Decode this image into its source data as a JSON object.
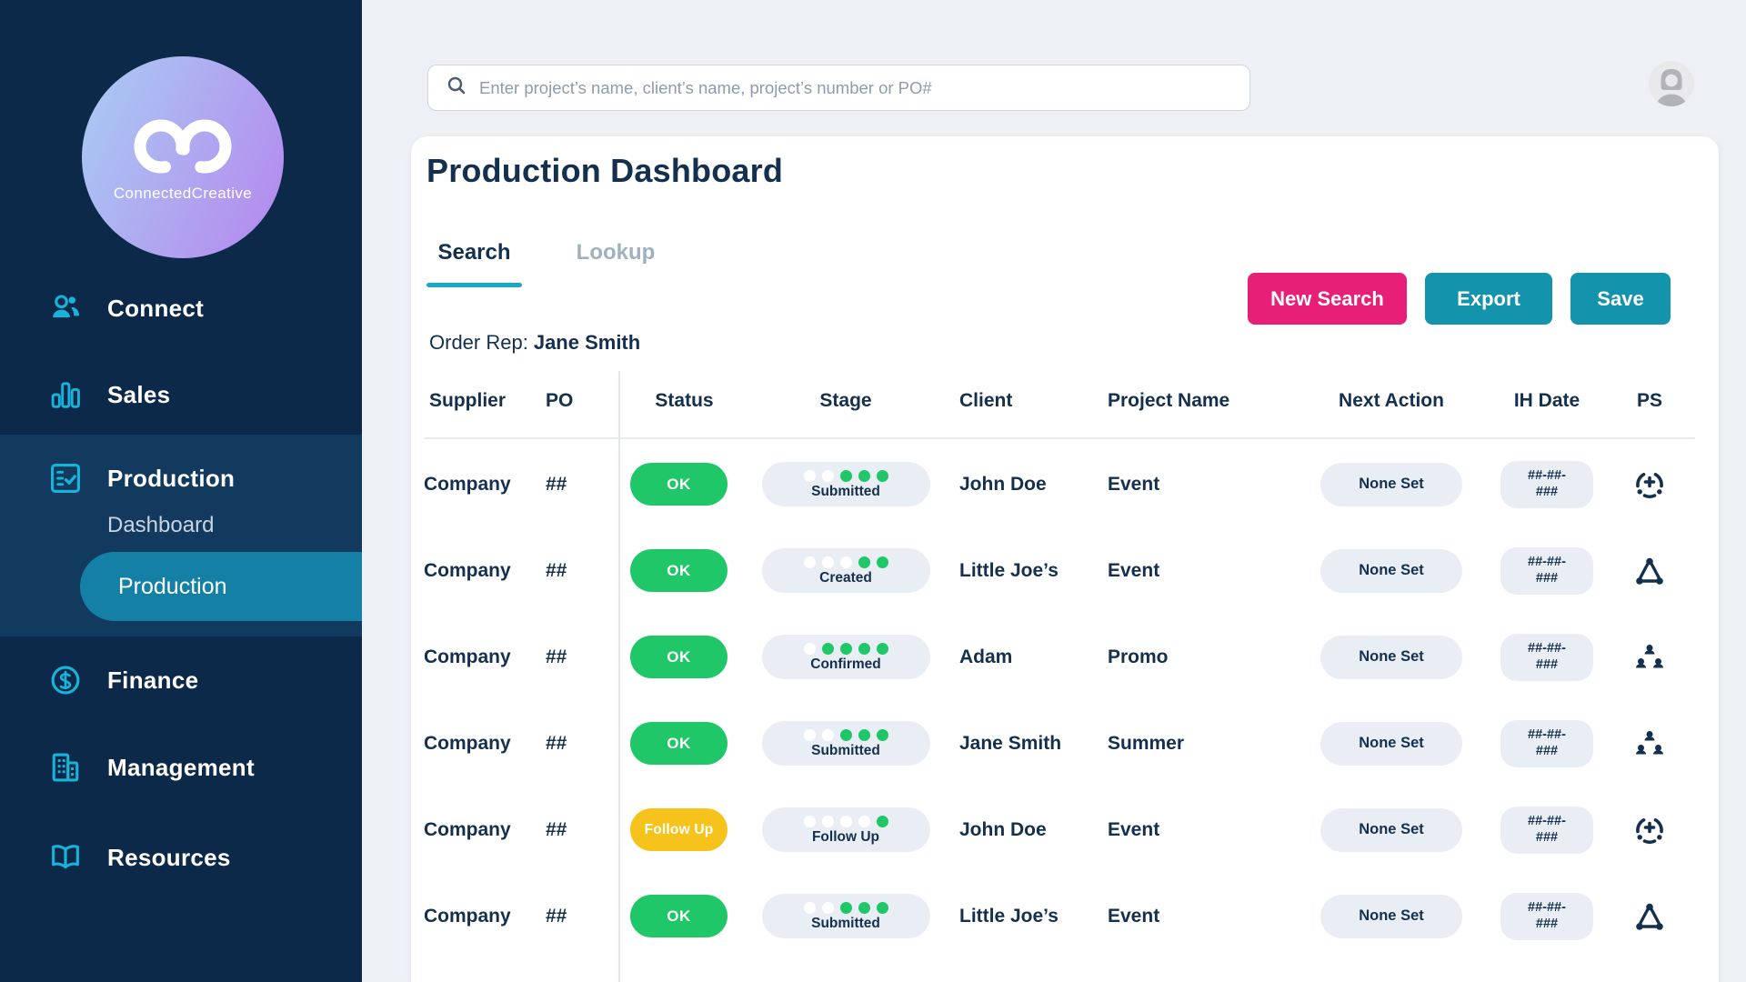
{
  "colors": {
    "sidebar_navy": "#0d2949",
    "section_navy": "#123a5f",
    "selected_teal": "#1480a6",
    "icon_cyan": "#18b3d9",
    "accent_pink": "#e81f76",
    "accent_teal": "#1494ac",
    "status_green": "#1fc768",
    "status_yellow": "#f5c31b",
    "text_navy": "#14304e",
    "pill_gray": "#e9eef5",
    "tab_underline": "#1aa9c4"
  },
  "sidebar": {
    "brand": "ConnectedCreative",
    "items": [
      {
        "label": "Connect",
        "icon": "users-icon"
      },
      {
        "label": "Sales",
        "icon": "bar-chart-icon"
      },
      {
        "label": "Production",
        "icon": "checklist-icon"
      },
      {
        "label": "Finance",
        "icon": "dollar-icon"
      },
      {
        "label": "Management",
        "icon": "building-icon"
      },
      {
        "label": "Resources",
        "icon": "book-icon"
      }
    ],
    "production_children": [
      {
        "label": "Dashboard",
        "selected": false
      },
      {
        "label": "Production",
        "selected": true
      }
    ]
  },
  "topbar": {
    "search_placeholder": "Enter project’s name, client’s name, project’s number or PO#"
  },
  "main": {
    "title": "Production Dashboard",
    "tabs": [
      {
        "label": "Search",
        "active": true
      },
      {
        "label": "Lookup",
        "active": false
      }
    ],
    "order_rep_label": "Order Rep:",
    "order_rep_value": "Jane Smith",
    "buttons": {
      "new_search": "New Search",
      "export": "Export",
      "save": "Save"
    }
  },
  "table": {
    "columns": [
      "Supplier",
      "PO",
      "Status",
      "Stage",
      "Client",
      "Project Name",
      "Next Action",
      "IH Date",
      "PS"
    ],
    "stage_dots_total": 5,
    "rows": [
      {
        "supplier": "Company",
        "po": "##",
        "status": "OK",
        "status_type": "ok",
        "stage": "Submitted",
        "stage_filled": 3,
        "client": "John Doe",
        "project": "Event",
        "next_action": "None Set",
        "ih_line1": "##-##-",
        "ih_line2": "###",
        "ps_icon": "target-plus-icon"
      },
      {
        "supplier": "Company",
        "po": "##",
        "status": "OK",
        "status_type": "ok",
        "stage": "Created",
        "stage_filled": 2,
        "client": "Little Joe’s",
        "project": "Event",
        "next_action": "None Set",
        "ih_line1": "##-##-",
        "ih_line2": "###",
        "ps_icon": "triangle-network-icon"
      },
      {
        "supplier": "Company",
        "po": "##",
        "status": "OK",
        "status_type": "ok",
        "stage": "Confirmed",
        "stage_filled": 4,
        "client": "Adam",
        "project": "Promo",
        "next_action": "None Set",
        "ih_line1": "##-##-",
        "ih_line2": "###",
        "ps_icon": "people-hierarchy-icon"
      },
      {
        "supplier": "Company",
        "po": "##",
        "status": "OK",
        "status_type": "ok",
        "stage": "Submitted",
        "stage_filled": 3,
        "client": "Jane Smith",
        "project": "Summer",
        "next_action": "None Set",
        "ih_line1": "##-##-",
        "ih_line2": "###",
        "ps_icon": "people-hierarchy-icon"
      },
      {
        "supplier": "Company",
        "po": "##",
        "status": "Follow Up",
        "status_type": "follow-up",
        "stage": "Follow Up",
        "stage_filled": 1,
        "client": "John Doe",
        "project": "Event",
        "next_action": "None Set",
        "ih_line1": "##-##-",
        "ih_line2": "###",
        "ps_icon": "target-plus-icon"
      },
      {
        "supplier": "Company",
        "po": "##",
        "status": "OK",
        "status_type": "ok",
        "stage": "Submitted",
        "stage_filled": 3,
        "client": "Little Joe’s",
        "project": "Event",
        "next_action": "None Set",
        "ih_line1": "##-##-",
        "ih_line2": "###",
        "ps_icon": "triangle-network-icon"
      }
    ]
  }
}
